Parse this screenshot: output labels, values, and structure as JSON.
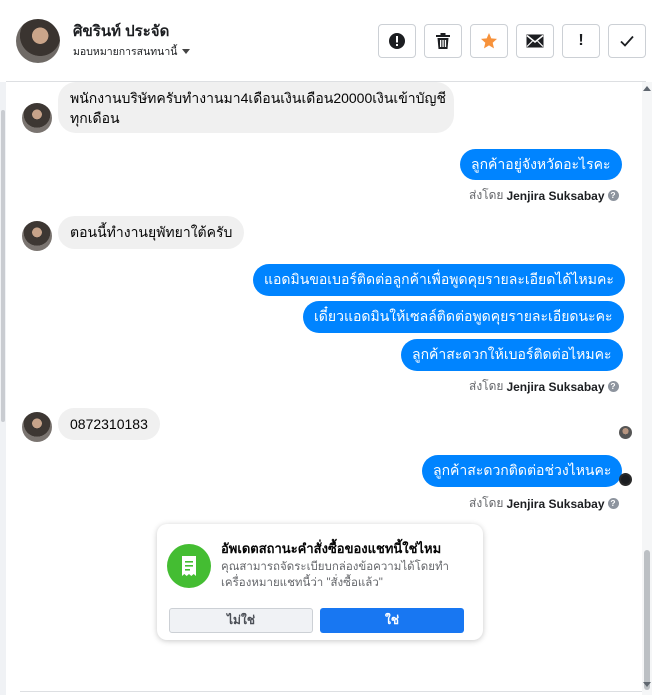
{
  "header": {
    "name": "ศิขรินท์ ประจัด",
    "assign_label": "มอบหมายการสนทนานี้",
    "actions": [
      {
        "name": "spam-button",
        "icon": "exclamation-circle-icon"
      },
      {
        "name": "delete-button",
        "icon": "trash-icon"
      },
      {
        "name": "star-button",
        "icon": "star-icon",
        "color": "#f7923b"
      },
      {
        "name": "email-button",
        "icon": "envelope-icon"
      },
      {
        "name": "follow-up-button",
        "icon": "exclamation-icon",
        "text": "!"
      },
      {
        "name": "mark-done-button",
        "icon": "check-icon"
      }
    ]
  },
  "messages": [
    {
      "direction": "in",
      "text_line1": "พนักงานบริษัทครับทำงานมา4เดือนเงินเดือน20000เงินเข้าบัญชี",
      "text_line2": "ทุกเดือน"
    },
    {
      "direction": "out",
      "text": "ลูกค้าอยู่จังหวัดอะไรคะ"
    },
    {
      "direction": "sent_by",
      "prefix": "ส่งโดย",
      "agent": "Jenjira Suksabay"
    },
    {
      "direction": "in",
      "text": "ตอนนี้ทำงานยุพัทยาใต้ครับ"
    },
    {
      "direction": "out",
      "text": "แอดมินขอเบอร์ติดต่อลูกค้าเพื่อพูดคุยรายละเอียดได้ไหมคะ"
    },
    {
      "direction": "out",
      "text": "เดี๋ยวแอดมินให้เซลล์ติดต่อพูดคุยรายละเอียดนะคะ"
    },
    {
      "direction": "out",
      "text": "ลูกค้าสะดวกให้เบอร์ติดต่อไหมคะ"
    },
    {
      "direction": "sent_by",
      "prefix": "ส่งโดย",
      "agent": "Jenjira Suksabay"
    },
    {
      "direction": "in",
      "text": "0872310183"
    },
    {
      "direction": "out",
      "text": "ลูกค้าสะดวกติดต่อช่วงไหนคะ"
    },
    {
      "direction": "sent_by",
      "prefix": "ส่งโดย",
      "agent": "Jenjira Suksabay"
    }
  ],
  "order_card": {
    "title": "อัพเดตสถานะคำสั่งซื้อของแชทนี้ใช่ไหม",
    "description": "คุณสามารถจัดระเบียบกล่องข้อความได้โดยทำเครื่องหมายแชทนี้ว่า \"สั่งซื้อแล้ว\"",
    "no_label": "ไม่ใช่",
    "yes_label": "ใช่",
    "icon": "receipt-icon"
  },
  "colors": {
    "outgoing_bubble": "#0084ff",
    "incoming_bubble": "#f0f0f0",
    "card_icon_bg": "#44bd32",
    "yes_button": "#1877f2",
    "star": "#f7923b"
  }
}
